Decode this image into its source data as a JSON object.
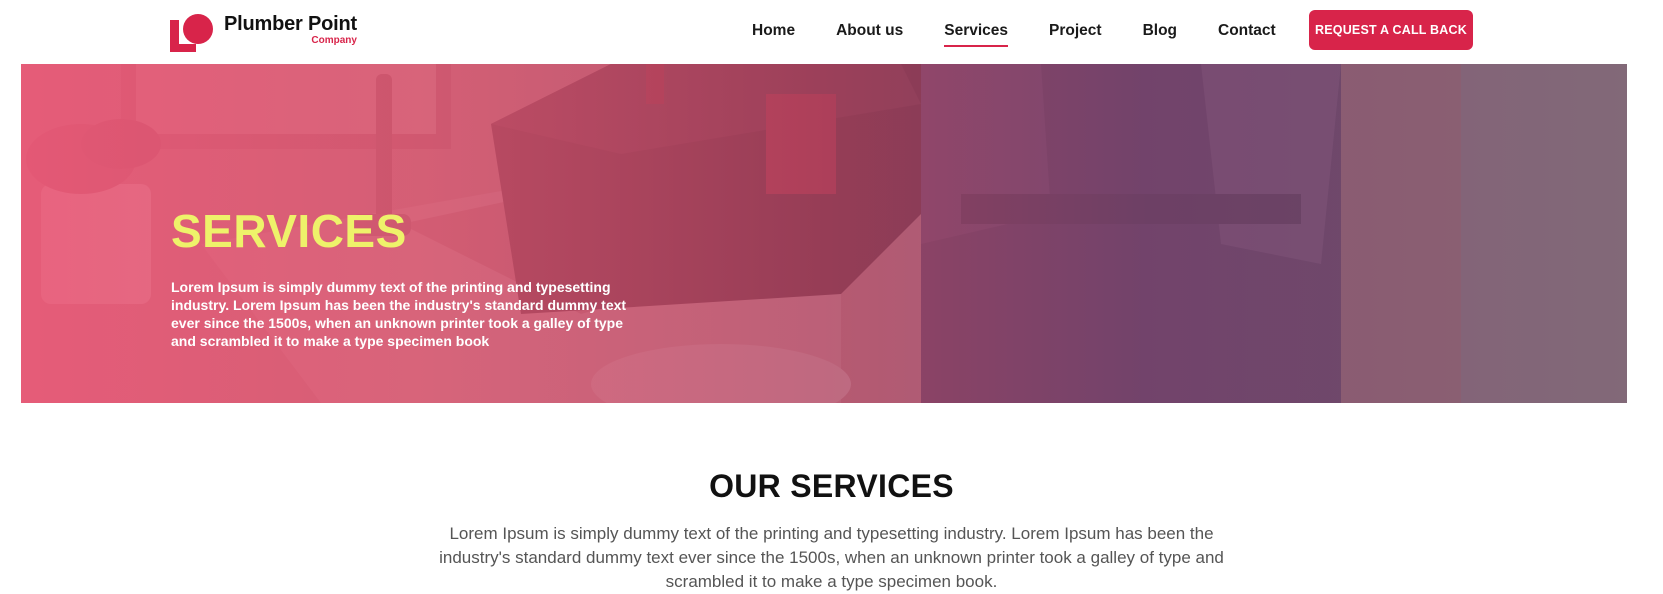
{
  "brand": {
    "name": "Plumber Point",
    "subtitle": "Company",
    "accent_color": "#d8244a",
    "logo_icon": "brand-logo-icon"
  },
  "nav": {
    "items": [
      {
        "label": "Home",
        "active": false
      },
      {
        "label": "About us",
        "active": false
      },
      {
        "label": "Services",
        "active": true
      },
      {
        "label": "Project",
        "active": false
      },
      {
        "label": "Blog",
        "active": false
      },
      {
        "label": "Contact",
        "active": false
      }
    ],
    "cta_label": "REQUEST A CALL BACK"
  },
  "hero": {
    "title": "SERVICES",
    "title_color": "#eef26a",
    "text": "Lorem Ipsum is simply dummy text of the printing and typesetting industry. Lorem Ipsum has been the industry's standard dummy text ever since the 1500s, when an unknown printer took a galley of type and scrambled it to make a type specimen book"
  },
  "services": {
    "title": "OUR SERVICES",
    "text": "Lorem Ipsum is simply dummy text of the printing and typesetting industry. Lorem Ipsum has been the industry's standard dummy text ever since the 1500s, when an unknown printer took a galley of type and scrambled it to make a type specimen book."
  }
}
